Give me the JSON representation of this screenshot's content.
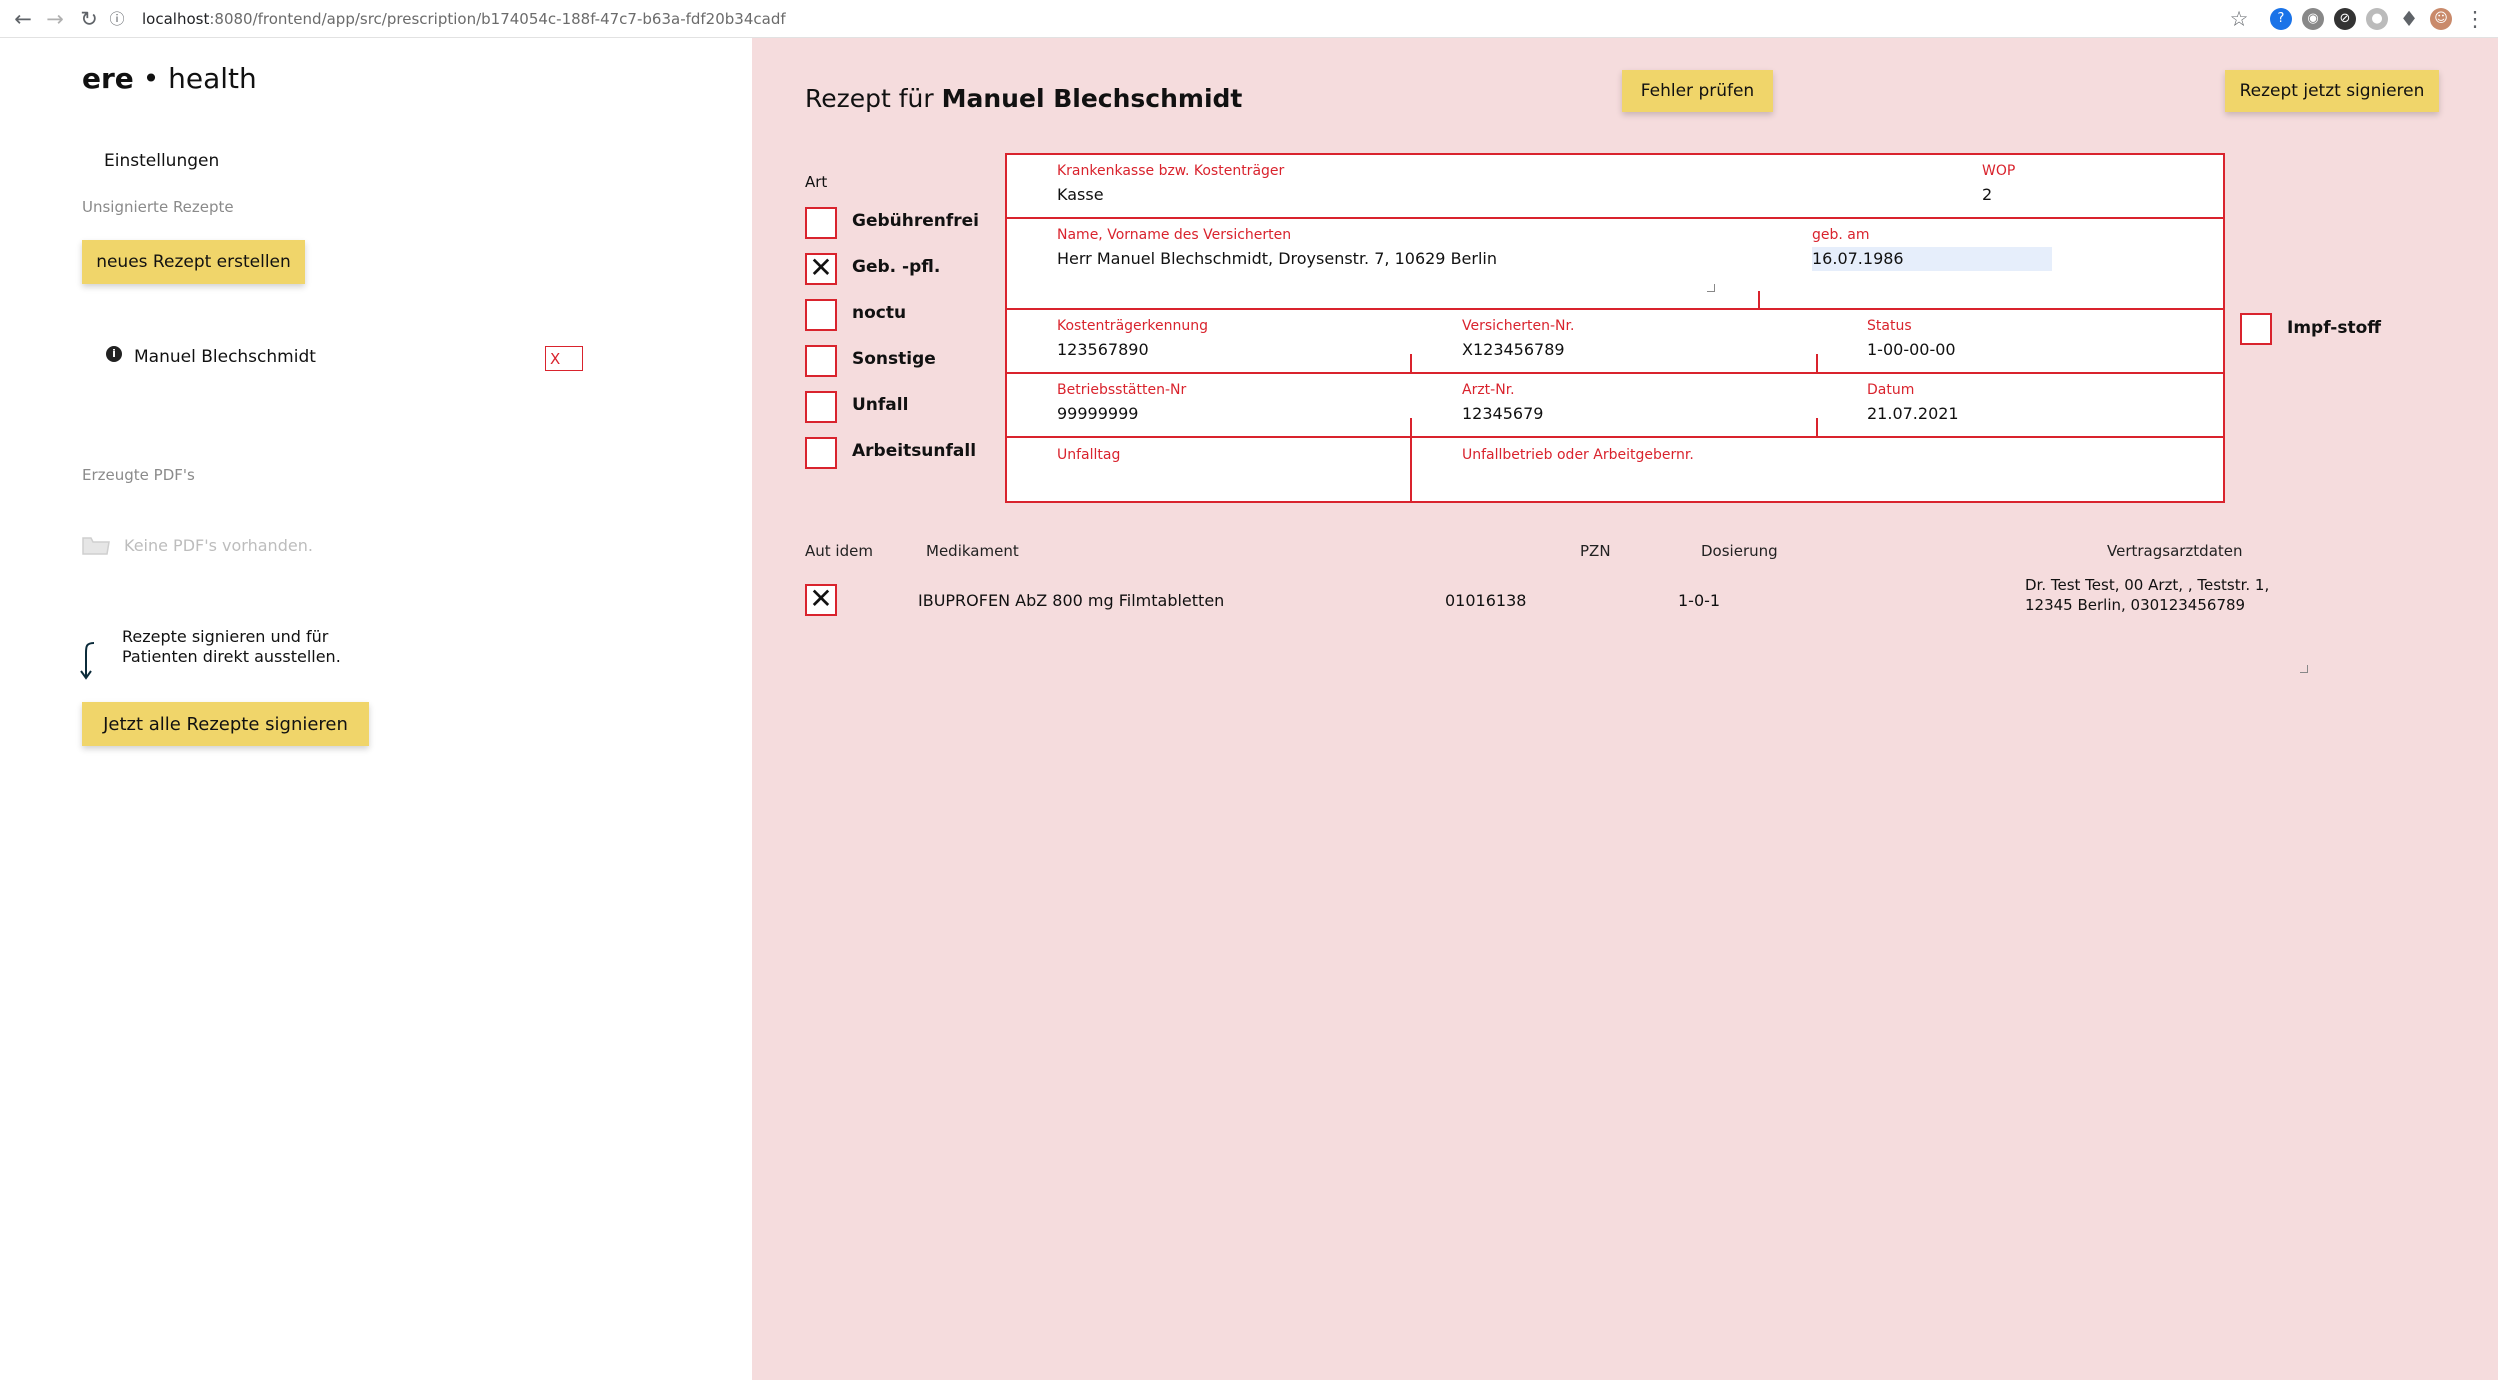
{
  "browser": {
    "url_host": "localhost",
    "url_path": ":8080/frontend/app/src/prescription/b174054c-188f-47c7-b63a-fdf20b34cadf"
  },
  "sidebar": {
    "logo_bold": "ere",
    "logo_sep": "•",
    "logo_light": "health",
    "settings_label": "Einstellungen",
    "unsigned_heading": "Unsignierte Rezepte",
    "new_prescription_label": "neues Rezept erstellen",
    "patient_name": "Manuel Blechschmidt",
    "delete_label": "X",
    "pdfs_heading": "Erzeugte PDF's",
    "no_pdfs_label": "Keine PDF's vorhanden.",
    "sign_hint_line1": "Rezepte signieren und für",
    "sign_hint_line2": "Patienten direkt ausstellen.",
    "sign_all_label": "Jetzt alle Rezepte signieren"
  },
  "header": {
    "title_prefix": "Rezept für",
    "title_name": "Manuel Blechschmidt",
    "check_errors_label": "Fehler prüfen",
    "sign_now_label": "Rezept jetzt signieren"
  },
  "art": {
    "heading": "Art",
    "options": [
      {
        "label": "Gebührenfrei",
        "checked": false
      },
      {
        "label": "Geb. -pfl.",
        "checked": true
      },
      {
        "label": "noctu",
        "checked": false
      },
      {
        "label": "Sonstige",
        "checked": false
      },
      {
        "label": "Unfall",
        "checked": false
      },
      {
        "label": "Arbeitsunfall",
        "checked": false
      }
    ],
    "vaccine_label": "Impf-stoff",
    "vaccine_checked": false
  },
  "form": {
    "insurer_label": "Krankenkasse bzw. Kostenträger",
    "insurer_value": "Kasse",
    "wop_label": "WOP",
    "wop_value": "2",
    "name_label": "Name, Vorname des Versicherten",
    "name_value": "Herr Manuel Blechschmidt, Droysenstr. 7, 10629 Berlin",
    "dob_label": "geb. am",
    "dob_value": "16.07.1986",
    "payer_id_label": "Kostenträgerkennung",
    "payer_id_value": "123567890",
    "insured_no_label": "Versicherten-Nr.",
    "insured_no_value": "X123456789",
    "status_label": "Status",
    "status_value": "1-00-00-00",
    "site_no_label": "Betriebsstätten-Nr",
    "site_no_value": "99999999",
    "doctor_no_label": "Arzt-Nr.",
    "doctor_no_value": "12345679",
    "date_label": "Datum",
    "date_value": "21.07.2021",
    "accident_day_label": "Unfalltag",
    "accident_employer_label": "Unfallbetrieb oder Arbeitgebernr."
  },
  "medication": {
    "headers": {
      "aut_idem": "Aut idem",
      "drug": "Medikament",
      "pzn": "PZN",
      "dosage": "Dosierung",
      "doctor": "Vertragsarztdaten"
    },
    "rows": [
      {
        "aut_idem": true,
        "drug": "IBUPROFEN AbZ 800 mg Filmtabletten",
        "pzn": "01016138",
        "dosage": "1-0-1",
        "doctor_line1": "Dr. Test Test, 00 Arzt, , Teststr. 1,",
        "doctor_line2": "12345 Berlin, 030123456789"
      }
    ]
  },
  "colors": {
    "accent_red": "#d9232d",
    "button_yellow": "#f0d56a",
    "pane_pink": "#f5dcdd"
  }
}
